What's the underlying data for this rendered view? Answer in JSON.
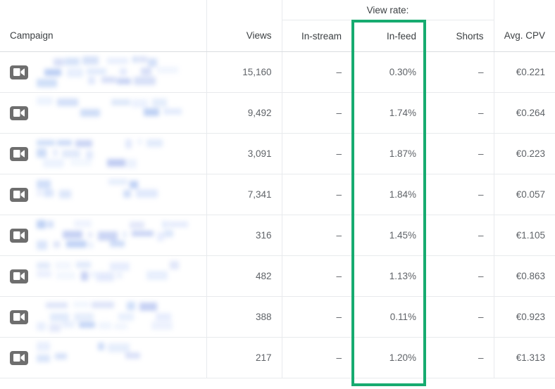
{
  "table": {
    "group_header": {
      "view_rate_label": "View rate:"
    },
    "columns": {
      "campaign": "Campaign",
      "views": "Views",
      "in_stream": "In-stream",
      "in_feed": "In-feed",
      "shorts": "Shorts",
      "avg_cpv": "Avg. CPV"
    },
    "empty_value": "–",
    "row_icon": "video-camera-icon",
    "rows": [
      {
        "campaign": "",
        "views": "15,160",
        "in_stream": "–",
        "in_feed": "0.30%",
        "shorts": "–",
        "avg_cpv": "€0.221"
      },
      {
        "campaign": "",
        "views": "9,492",
        "in_stream": "–",
        "in_feed": "1.74%",
        "shorts": "–",
        "avg_cpv": "€0.264"
      },
      {
        "campaign": "",
        "views": "3,091",
        "in_stream": "–",
        "in_feed": "1.87%",
        "shorts": "–",
        "avg_cpv": "€0.223"
      },
      {
        "campaign": "",
        "views": "7,341",
        "in_stream": "–",
        "in_feed": "1.84%",
        "shorts": "–",
        "avg_cpv": "€0.057"
      },
      {
        "campaign": "",
        "views": "316",
        "in_stream": "–",
        "in_feed": "1.45%",
        "shorts": "–",
        "avg_cpv": "€1.105"
      },
      {
        "campaign": "",
        "views": "482",
        "in_stream": "–",
        "in_feed": "1.13%",
        "shorts": "–",
        "avg_cpv": "€0.863"
      },
      {
        "campaign": "",
        "views": "388",
        "in_stream": "–",
        "in_feed": "0.11%",
        "shorts": "–",
        "avg_cpv": "€0.923"
      },
      {
        "campaign": "",
        "views": "217",
        "in_stream": "–",
        "in_feed": "1.20%",
        "shorts": "–",
        "avg_cpv": "€1.313"
      }
    ]
  },
  "annotation": {
    "highlight_column": "In-feed",
    "highlight_color": "#17ab70"
  },
  "colors": {
    "text": "#3c4043",
    "muted_text": "#5f6368",
    "border": "#e8eaed",
    "border_strong": "#dadce0",
    "icon_bg": "#6e6e6e",
    "redaction": "#a8c0f0"
  }
}
